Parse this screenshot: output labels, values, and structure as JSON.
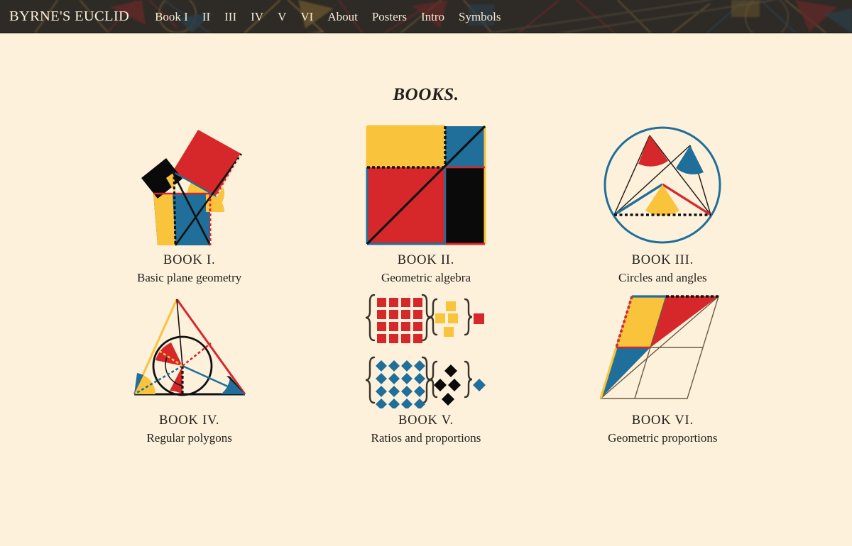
{
  "nav": {
    "brand": "BYRNE'S EUCLID",
    "links": [
      {
        "label": "Book I",
        "name": "nav-book-1"
      },
      {
        "label": "II",
        "name": "nav-book-2"
      },
      {
        "label": "III",
        "name": "nav-book-3"
      },
      {
        "label": "IV",
        "name": "nav-book-4"
      },
      {
        "label": "V",
        "name": "nav-book-5"
      },
      {
        "label": "VI",
        "name": "nav-book-6"
      },
      {
        "label": "About",
        "name": "nav-about"
      },
      {
        "label": "Posters",
        "name": "nav-posters"
      },
      {
        "label": "Intro",
        "name": "nav-intro"
      },
      {
        "label": "Symbols",
        "name": "nav-symbols"
      }
    ]
  },
  "page": {
    "title": "BOOKS."
  },
  "books": [
    {
      "title": "BOOK I.",
      "subtitle": "Basic plane geometry",
      "figure": "pythagorean-theorem-figure"
    },
    {
      "title": "BOOK II.",
      "subtitle": "Geometric algebra",
      "figure": "divided-square-figure"
    },
    {
      "title": "BOOK III.",
      "subtitle": "Circles and angles",
      "figure": "inscribed-angles-circle-figure"
    },
    {
      "title": "BOOK IV.",
      "subtitle": "Regular polygons",
      "figure": "incircle-triangle-figure"
    },
    {
      "title": "BOOK V.",
      "subtitle": "Ratios and proportions",
      "figure": "ratio-magnitudes-figure"
    },
    {
      "title": "BOOK VI.",
      "subtitle": "Geometric proportions",
      "figure": "parallelogram-proportions-figure"
    }
  ],
  "colors": {
    "background": "#FDF1DC",
    "nav_background": "#2E2A26",
    "nav_text": "#F6EAD4",
    "red": "#D6282B",
    "blue": "#1F6F9A",
    "yellow": "#F9C33C",
    "black": "#0A0A0A",
    "ink": "#241f1c"
  }
}
